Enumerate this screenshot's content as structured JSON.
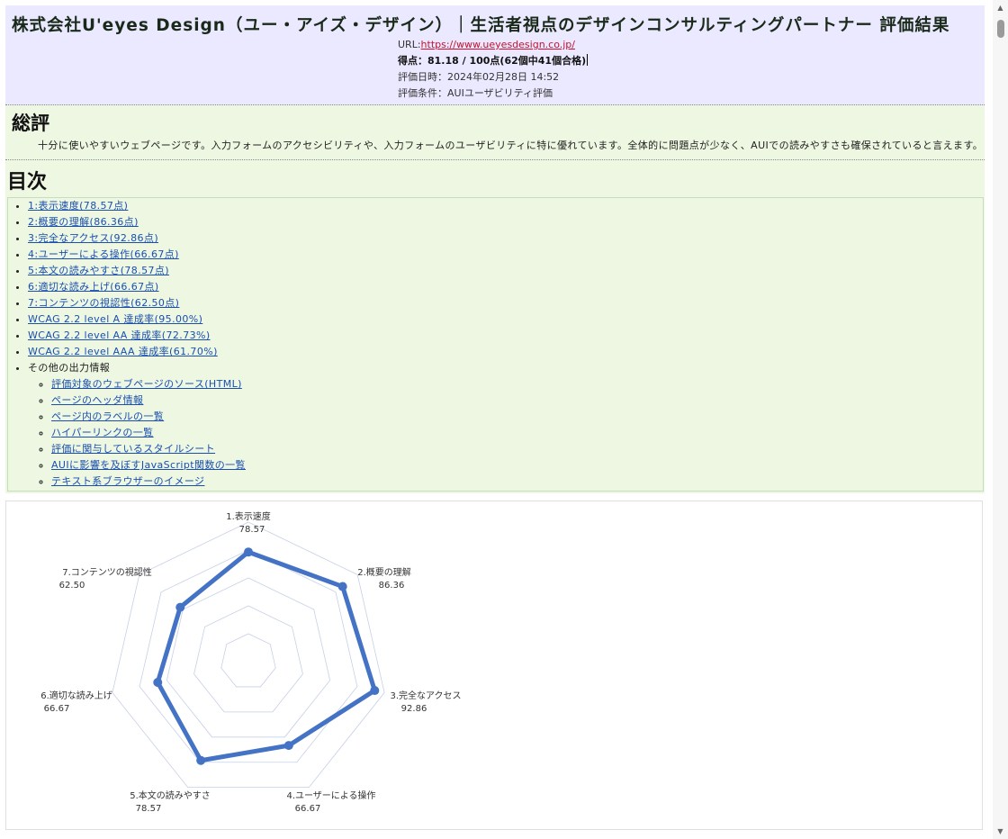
{
  "header": {
    "title": "株式会社U'eyes Design（ユー・アイズ・デザイン）｜生活者視点のデザインコンサルティングパートナー 評価結果",
    "url_label": "URL:",
    "url": "https://www.ueyesdesign.co.jp/",
    "score": "得点：81.18 / 100点(62個中41個合格)",
    "date": "評価日時：2024年02月28日 14:52",
    "condition": "評価条件：AUIユーザビリティ評価"
  },
  "summary": {
    "heading": "総評",
    "text": "十分に使いやすいウェブページです。入力フォームのアクセシビリティや、入力フォームのユーザビリティに特に優れています。全体的に問題点が少なく、AUIでの読みやすさも確保されていると言えます。"
  },
  "toc": {
    "heading": "目次",
    "items": [
      "1:表示速度(78.57点)",
      "2:概要の理解(86.36点)",
      "3:完全なアクセス(92.86点)",
      "4:ユーザーによる操作(66.67点)",
      "5:本文の読みやすさ(78.57点)",
      "6:適切な読み上げ(66.67点)",
      "7:コンテンツの視認性(62.50点)",
      "WCAG 2.2 level A 達成率(95.00%)",
      "WCAG 2.2 level AA 達成率(72.73%)",
      "WCAG 2.2 level AAA 達成率(61.70%)"
    ],
    "other_label": "その他の出力情報",
    "sub_items": [
      "評価対象のウェブページのソース(HTML)",
      "ページのヘッダ情報",
      "ページ内のラベルの一覧",
      "ハイパーリンクの一覧",
      "評価に関与しているスタイルシート",
      "AUIに影響を及ぼすJavaScript関数の一覧",
      "テキスト系ブラウザーのイメージ"
    ]
  },
  "chart_data": {
    "type": "radar",
    "categories": [
      "1.表示速度",
      "2.概要の理解",
      "3.完全なアクセス",
      "4.ユーザーによる操作",
      "5.本文の読みやすさ",
      "6.適切な読み上げ",
      "7.コンテンツの視認性"
    ],
    "values": [
      78.57,
      86.36,
      92.86,
      66.67,
      78.57,
      66.67,
      62.5
    ],
    "value_labels": [
      "78.57",
      "86.36",
      "92.86",
      "66.67",
      "78.57",
      "66.67",
      "62.50"
    ],
    "range": [
      0,
      100
    ],
    "grid_levels": 5,
    "series_color": "#4472c4",
    "grid_color": "#c5d0e6"
  },
  "colors": {
    "header_bg": "#ebe9ff",
    "section_bg": "#eef7e1",
    "link": "#1a4fb0",
    "url_link": "#c8102e"
  }
}
